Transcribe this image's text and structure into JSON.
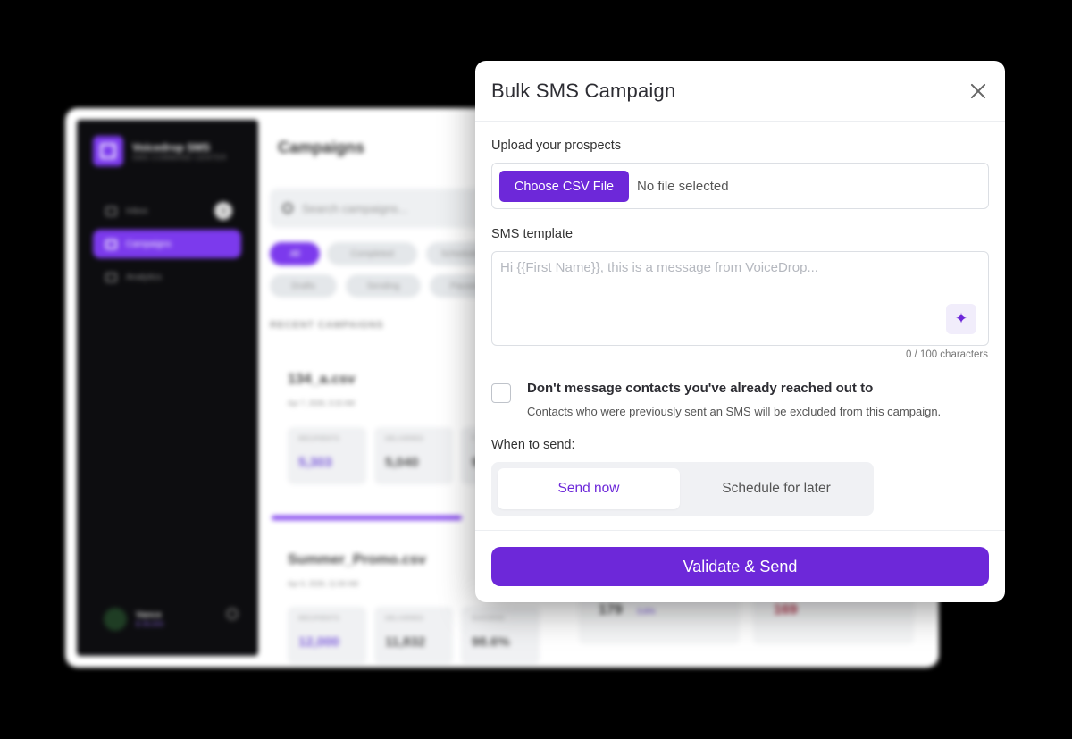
{
  "background_app": {
    "brand": {
      "name": "Voicedrop SMS",
      "subtitle": "SMS COMMAND CENTER"
    },
    "nav": [
      {
        "label": "Inbox",
        "badge": "3"
      },
      {
        "label": "Campaigns"
      },
      {
        "label": "Analytics"
      }
    ],
    "user": {
      "name": "Vance",
      "credit": "$ 39,000"
    },
    "page_title": "Campaigns",
    "search_placeholder": "Search campaigns...",
    "filters": [
      "All",
      "Completed",
      "Scheduled",
      "Drafts",
      "Sending",
      "Paused"
    ],
    "section_label": "RECENT CAMPAIGNS",
    "campaigns": [
      {
        "name": "134_a.csv",
        "date": "Apr 7, 2026, 3:15 AM",
        "stats": [
          {
            "label": "RECIPIENTS",
            "value": "5,303"
          },
          {
            "label": "DELIVERED",
            "value": "5,040"
          },
          {
            "label": "T",
            "value": "9"
          }
        ]
      },
      {
        "name": "Summer_Promo.csv",
        "date": "Apr 6, 2026, 11:00 AM",
        "stats": [
          {
            "label": "RECIPIENTS",
            "value": "12,000"
          },
          {
            "label": "DELIVERED",
            "value": "11,832"
          },
          {
            "label": "SUCCESS",
            "value": "98.6%"
          }
        ]
      }
    ],
    "side_numbers": {
      "replies": "179",
      "replies_rate": "3.6%",
      "opt_outs": "169"
    }
  },
  "modal": {
    "title": "Bulk SMS Campaign",
    "upload": {
      "label": "Upload your prospects",
      "button": "Choose CSV File",
      "status": "No file selected"
    },
    "template": {
      "label": "SMS template",
      "placeholder": "Hi {{First Name}}, this is a message from VoiceDrop...",
      "char_count": "0 / 100 characters"
    },
    "dedupe": {
      "checked": false,
      "title": "Don't message contacts you've already reached out to",
      "description": "Contacts who were previously sent an SMS will be excluded from this campaign."
    },
    "timing": {
      "label": "When to send:",
      "options": [
        "Send now",
        "Schedule for later"
      ],
      "selected": "Send now"
    },
    "submit": "Validate & Send"
  },
  "colors": {
    "accent": "#6d28d9",
    "accent_light": "#f1edfb",
    "background": "#000000"
  }
}
